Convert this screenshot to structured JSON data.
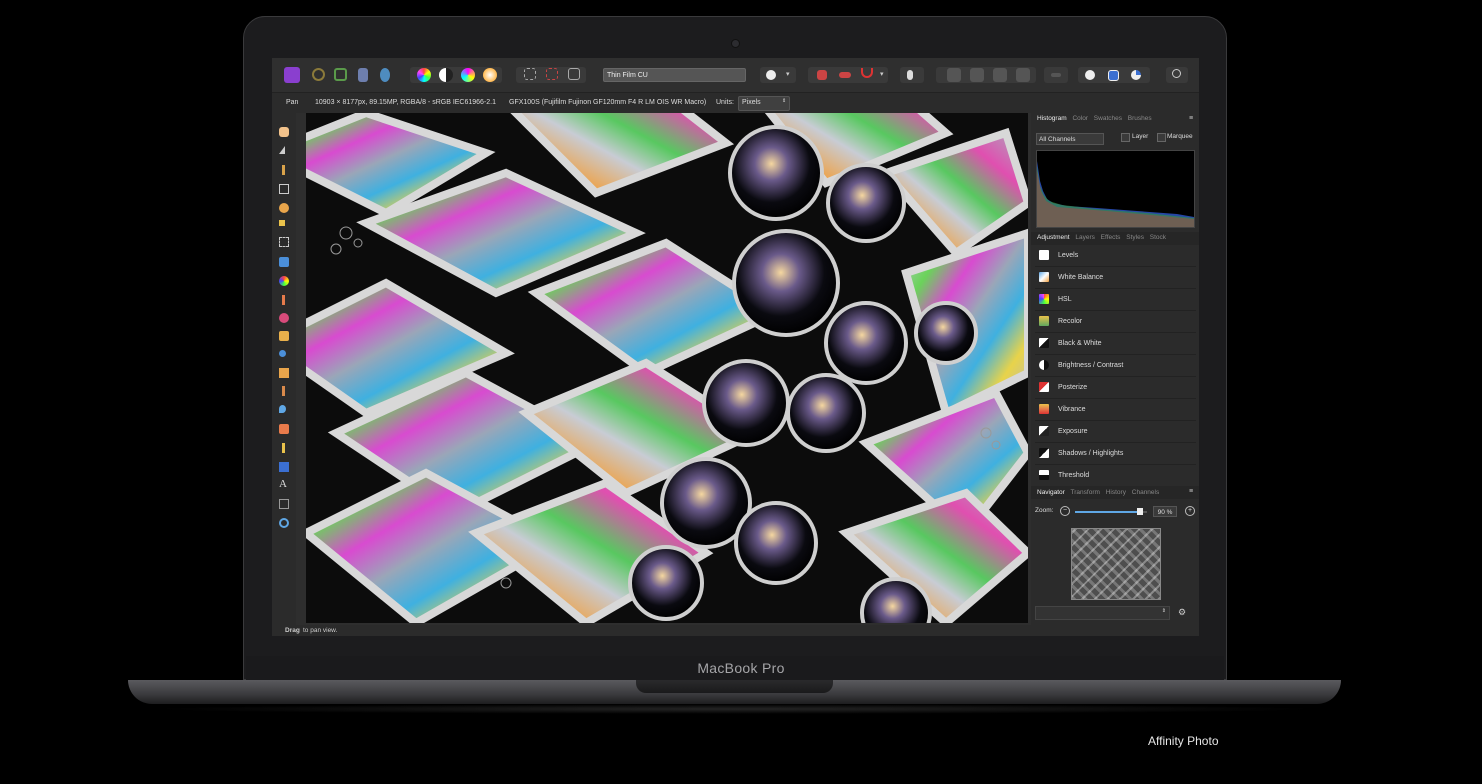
{
  "device": {
    "brand": "MacBook Pro"
  },
  "caption": "Affinity Photo",
  "toolbar": {
    "preset_name": "Thin Film CU"
  },
  "context": {
    "tool": "Pan",
    "doc_info": "10903 × 8177px, 89.15MP, RGBA/8 - sRGB IEC61966-2.1",
    "camera_info": "GFX100S (Fujifilm Fujinon GF120mm F4 R LM OIS WR Macro)",
    "units_label": "Units:",
    "units_value": "Pixels"
  },
  "studio_top": {
    "tabs": [
      "Histogram",
      "Color",
      "Swatches",
      "Brushes"
    ],
    "channel_select": "All Channels",
    "layer_label": "Layer",
    "marquee_label": "Marquee"
  },
  "studio_mid": {
    "tabs": [
      "Adjustment",
      "Layers",
      "Effects",
      "Styles",
      "Stock"
    ],
    "adjustments": [
      {
        "label": "Levels",
        "icon": "levels-icon"
      },
      {
        "label": "White Balance",
        "icon": "white-balance-icon"
      },
      {
        "label": "HSL",
        "icon": "hsl-icon"
      },
      {
        "label": "Recolor",
        "icon": "recolor-icon"
      },
      {
        "label": "Black & White",
        "icon": "black-white-icon"
      },
      {
        "label": "Brightness / Contrast",
        "icon": "brightness-contrast-icon"
      },
      {
        "label": "Posterize",
        "icon": "posterize-icon"
      },
      {
        "label": "Vibrance",
        "icon": "vibrance-icon"
      },
      {
        "label": "Exposure",
        "icon": "exposure-icon"
      },
      {
        "label": "Shadows / Highlights",
        "icon": "shadows-highlights-icon"
      },
      {
        "label": "Threshold",
        "icon": "threshold-icon"
      }
    ]
  },
  "studio_bottom": {
    "tabs": [
      "Navigator",
      "Transform",
      "History",
      "Channels"
    ],
    "zoom_label": "Zoom:",
    "zoom_value": "90 %",
    "zoom_fraction": 0.9
  },
  "status": {
    "bold": "Drag",
    "rest": " to pan view."
  },
  "colors": {
    "accent": "#8a3fcf",
    "panel": "#2b2b2b",
    "toolbar": "#2f2f2f",
    "highlight": "#3b6fd1"
  }
}
